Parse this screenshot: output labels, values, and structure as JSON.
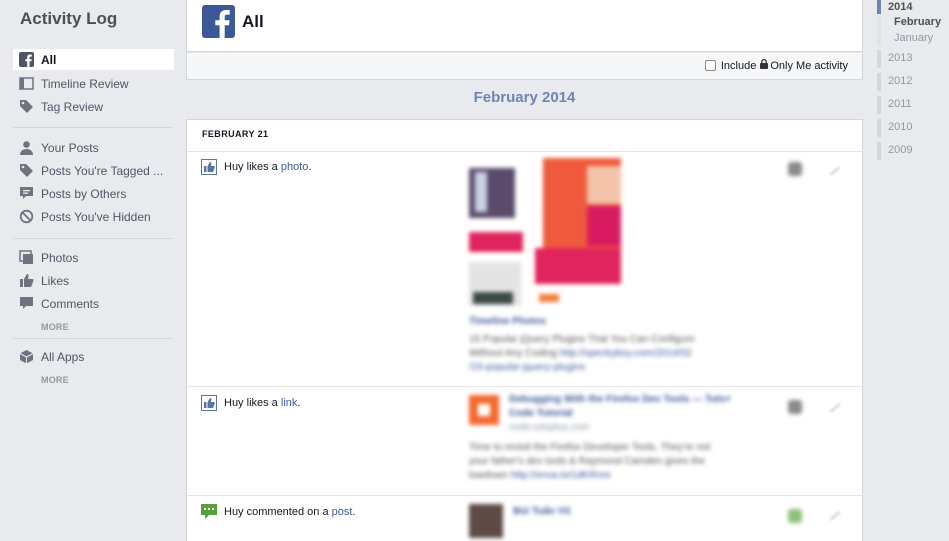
{
  "sidebar": {
    "title": "Activity Log",
    "group1": [
      {
        "label": "All",
        "icon": "facebook-icon",
        "active": true
      },
      {
        "label": "Timeline Review",
        "icon": "timeline-icon"
      },
      {
        "label": "Tag Review",
        "icon": "tag-icon"
      }
    ],
    "group2": [
      {
        "label": "Your Posts",
        "icon": "person-icon"
      },
      {
        "label": "Posts You're Tagged ...",
        "icon": "tag-icon"
      },
      {
        "label": "Posts by Others",
        "icon": "speech-bubble-icon"
      },
      {
        "label": "Posts You've Hidden",
        "icon": "hidden-icon"
      }
    ],
    "group3": [
      {
        "label": "Photos",
        "icon": "photos-icon"
      },
      {
        "label": "Likes",
        "icon": "thumbs-up-icon"
      },
      {
        "label": "Comments",
        "icon": "comment-icon"
      }
    ],
    "more1": "MORE",
    "group4": [
      {
        "label": "All Apps",
        "icon": "cube-icon"
      }
    ],
    "more2": "MORE"
  },
  "header": {
    "title": "All",
    "include_label": "Include",
    "only_me_label": "Only Me activity"
  },
  "month_title": "February 2014",
  "feed": {
    "day_header": "FEBRUARY 21",
    "stories": [
      {
        "actor": "Huy",
        "verb": "likes a",
        "object": "photo",
        "suffix": ".",
        "icon": "like-icon"
      },
      {
        "actor": "Huy",
        "verb": "likes a",
        "object": "link",
        "suffix": ".",
        "icon": "like-icon"
      },
      {
        "actor": "Huy",
        "verb": "commented on a",
        "object": "post",
        "suffix": ".",
        "icon": "comment-green-icon"
      }
    ]
  },
  "year_nav": {
    "years": [
      "2014",
      "2013",
      "2012",
      "2011",
      "2010",
      "2009"
    ],
    "months": [
      "February",
      "January"
    ],
    "active_year": "2014",
    "active_month": "February"
  },
  "colors": {
    "brand": "#3b5998",
    "background": "#e9eaed",
    "month_title": "#6d84b4"
  }
}
